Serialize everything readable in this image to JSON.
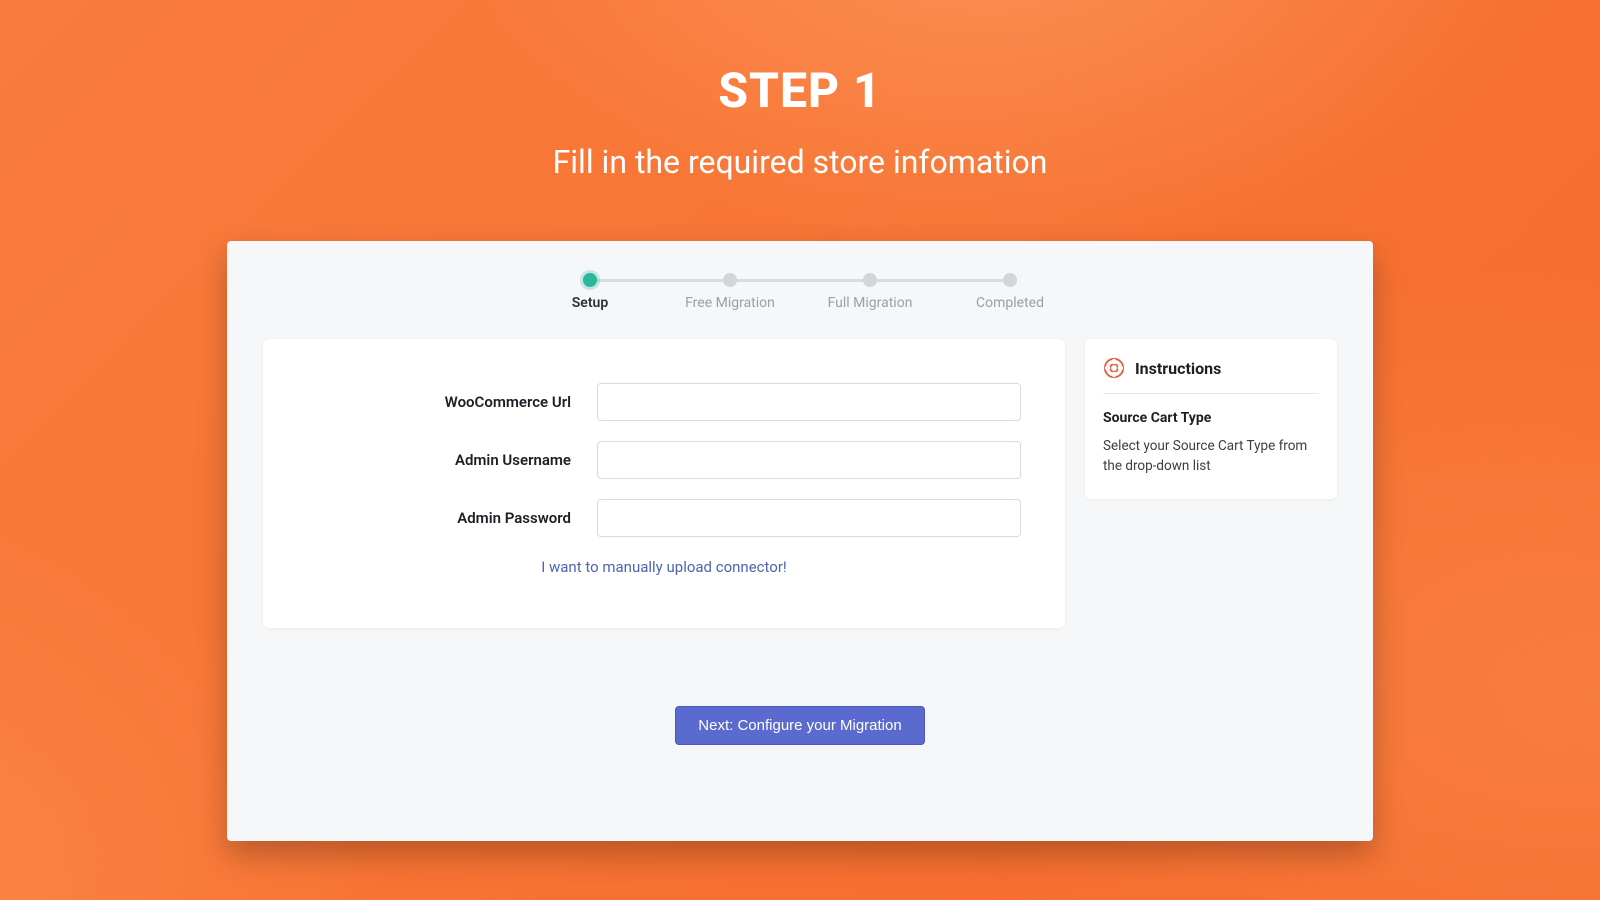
{
  "hero": {
    "title": "STEP 1",
    "subtitle": "Fill in the required store infomation"
  },
  "stepper": {
    "steps": [
      {
        "label": "Setup",
        "active": true
      },
      {
        "label": "Free Migration",
        "active": false
      },
      {
        "label": "Full Migration",
        "active": false
      },
      {
        "label": "Completed",
        "active": false
      }
    ]
  },
  "form": {
    "fields": {
      "url": {
        "label": "WooCommerce Url",
        "value": ""
      },
      "username": {
        "label": "Admin Username",
        "value": ""
      },
      "password": {
        "label": "Admin Password",
        "value": ""
      }
    },
    "manual_link": "I want to manually upload connector!"
  },
  "instructions": {
    "heading": "Instructions",
    "section_title": "Source Cart Type",
    "section_body": "Select your Source Cart Type from the drop-down list"
  },
  "actions": {
    "next_label": "Next: Configure your Migration"
  },
  "colors": {
    "accent": "#5a6acf",
    "step_active": "#2bb89a",
    "bg": "#f77a3a"
  }
}
